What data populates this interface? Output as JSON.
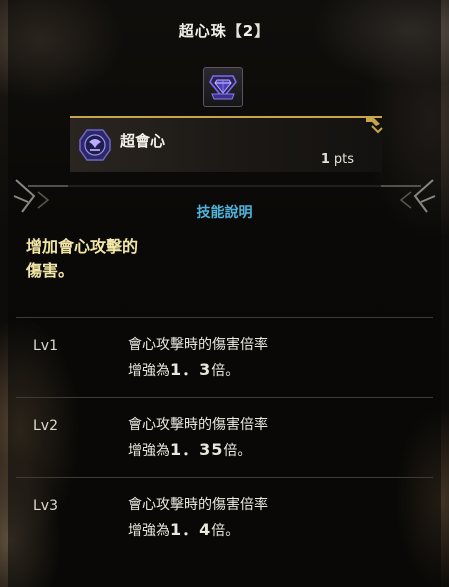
{
  "title": {
    "prefix": "超心珠",
    "bracket_open": "【",
    "level": "2",
    "bracket_close": "】"
  },
  "jewel": {
    "icon": "diamond-jewel-icon",
    "color": "#6a5ce0"
  },
  "skill": {
    "name": "超會心",
    "points_value": "1",
    "points_unit": "pts",
    "icon": "skill-emblem-icon"
  },
  "section_label": "技能說明",
  "description": {
    "line1": "增加會心攻擊的",
    "line2": "傷害。"
  },
  "levels": [
    {
      "label": "Lv1",
      "line1": "會心攻擊時的傷害倍率",
      "prefix": "增強為",
      "value": "1．3",
      "suffix": "倍。"
    },
    {
      "label": "Lv2",
      "line1": "會心攻擊時的傷害倍率",
      "prefix": "增強為",
      "value": "1．35",
      "suffix": "倍。"
    },
    {
      "label": "Lv3",
      "line1": "會心攻擊時的傷害倍率",
      "prefix": "增強為",
      "value": "1．4",
      "suffix": "倍。"
    }
  ],
  "colors": {
    "accent_gold": "#c9a54a",
    "section_blue": "#4fb4dc",
    "desc_yellow": "#f1e6a6"
  }
}
